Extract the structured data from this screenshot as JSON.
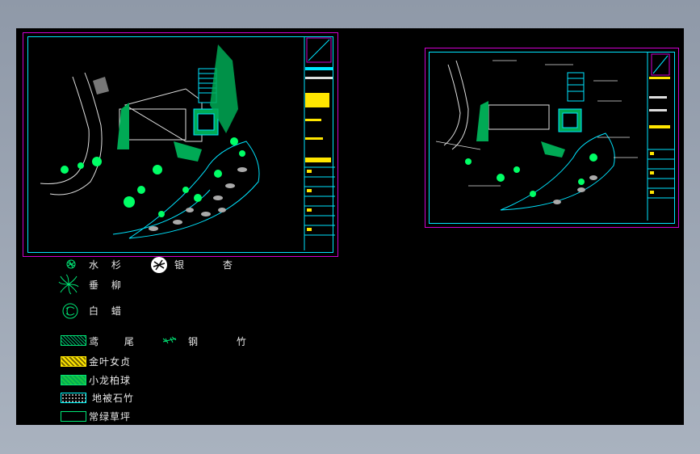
{
  "colors": {
    "background": "#000000",
    "sheet_border": "#d000d0",
    "frame": "#00e5ff",
    "plant_green": "#00e676",
    "path_white": "#e0e0e0",
    "title_yellow": "#ffe600"
  },
  "legend": {
    "items": [
      {
        "icon": "shuishan-tree-icon",
        "label": "水 杉"
      },
      {
        "icon": "yinxing-tree-icon",
        "label": "银 杏"
      },
      {
        "icon": "chuiliu-tree-icon",
        "label": "垂 柳"
      },
      {
        "icon": "bala-tree-icon",
        "label": "白 蜡"
      },
      {
        "icon": "yuanwei-hatch-icon",
        "label": "鸢 尾"
      },
      {
        "icon": "gangzhu-icon",
        "label": "钢 竹"
      },
      {
        "icon": "jinyenvzhen-hatch-icon",
        "label": "金叶女贞"
      },
      {
        "icon": "xiaolongbai-hatch-icon",
        "label": "小龙柏球"
      },
      {
        "icon": "dibeishizhu-hatch-icon",
        "label": "地被石竹"
      },
      {
        "icon": "changlvcaoping-hatch-icon",
        "label": "常绿草坪"
      }
    ]
  }
}
